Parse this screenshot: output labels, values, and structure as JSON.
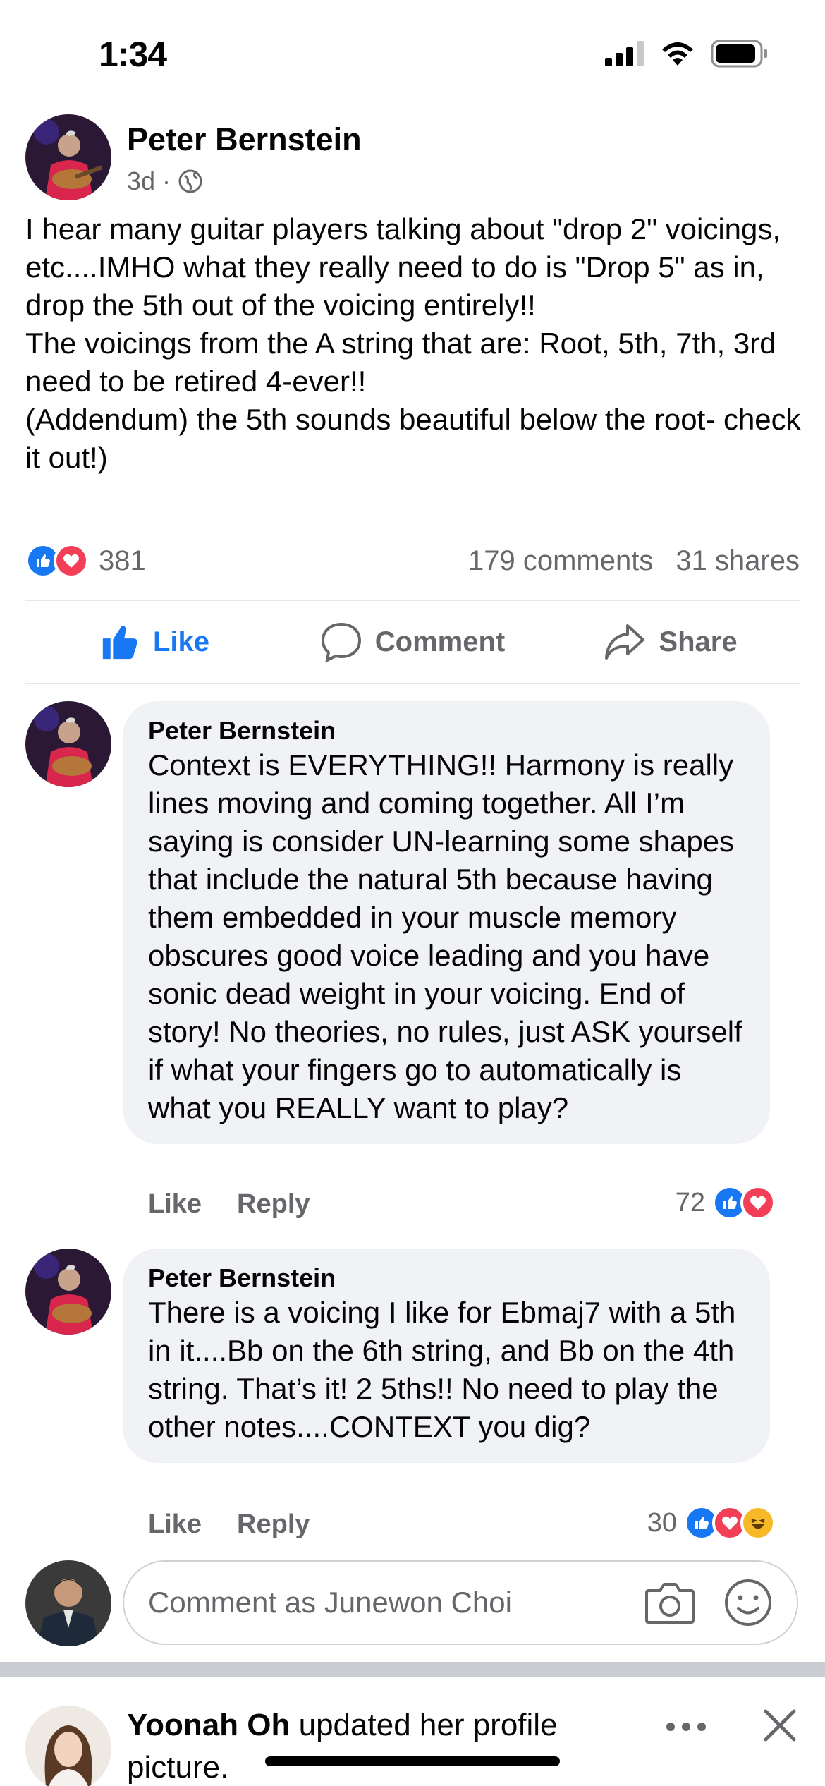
{
  "status_bar": {
    "time": "1:34"
  },
  "post": {
    "author": "Peter Bernstein",
    "time_ago": "3d",
    "separator": "·",
    "audience_icon": "globe-icon",
    "body_lines": [
      "I hear many guitar players talking about \"drop 2\" voicings, etc....IMHO what they really need to do is \"Drop 5\" as in, drop the 5th out of the voicing entirely!!",
      "The voicings from the A string that are: Root, 5th, 7th, 3rd need to be retired 4-ever!!",
      "(Addendum) the 5th sounds beautiful below the root- check it out!)"
    ],
    "reaction_count": "381",
    "comments_count": "179 comments",
    "shares_count": "31 shares"
  },
  "actions": {
    "like": "Like",
    "comment": "Comment",
    "share": "Share"
  },
  "comments": [
    {
      "author": "Peter Bernstein",
      "text": "Context is EVERYTHING!! Harmony is really lines moving and coming together. All I’m saying is consider UN-learning some shapes that include the natural 5th because having them embedded in your muscle memory obscures good voice leading and you have sonic dead weight in your voicing. End of story! No theories, no rules, just ASK yourself if what your fingers go to automatically is what you REALLY want to play?",
      "like": "Like",
      "reply": "Reply",
      "reaction_count": "72"
    },
    {
      "author": "Peter Bernstein",
      "text": "There is a voicing I like for Ebmaj7 with a 5th in it....Bb on the 6th string, and Bb on the 4th string. That’s it! 2 5ths!! No need to play the other notes....CONTEXT you dig?",
      "like": "Like",
      "reply": "Reply",
      "reaction_count": "30"
    }
  ],
  "composer": {
    "placeholder": "Comment as Junewon Choi"
  },
  "next_story": {
    "name": "Yoonah Oh",
    "action": " updated her profile picture."
  },
  "colors": {
    "facebook_blue": "#1877f2",
    "love_red": "#f33e58",
    "haha_yellow": "#f7b928",
    "secondary_text": "#65676b",
    "bubble_bg": "#f0f2f5"
  }
}
